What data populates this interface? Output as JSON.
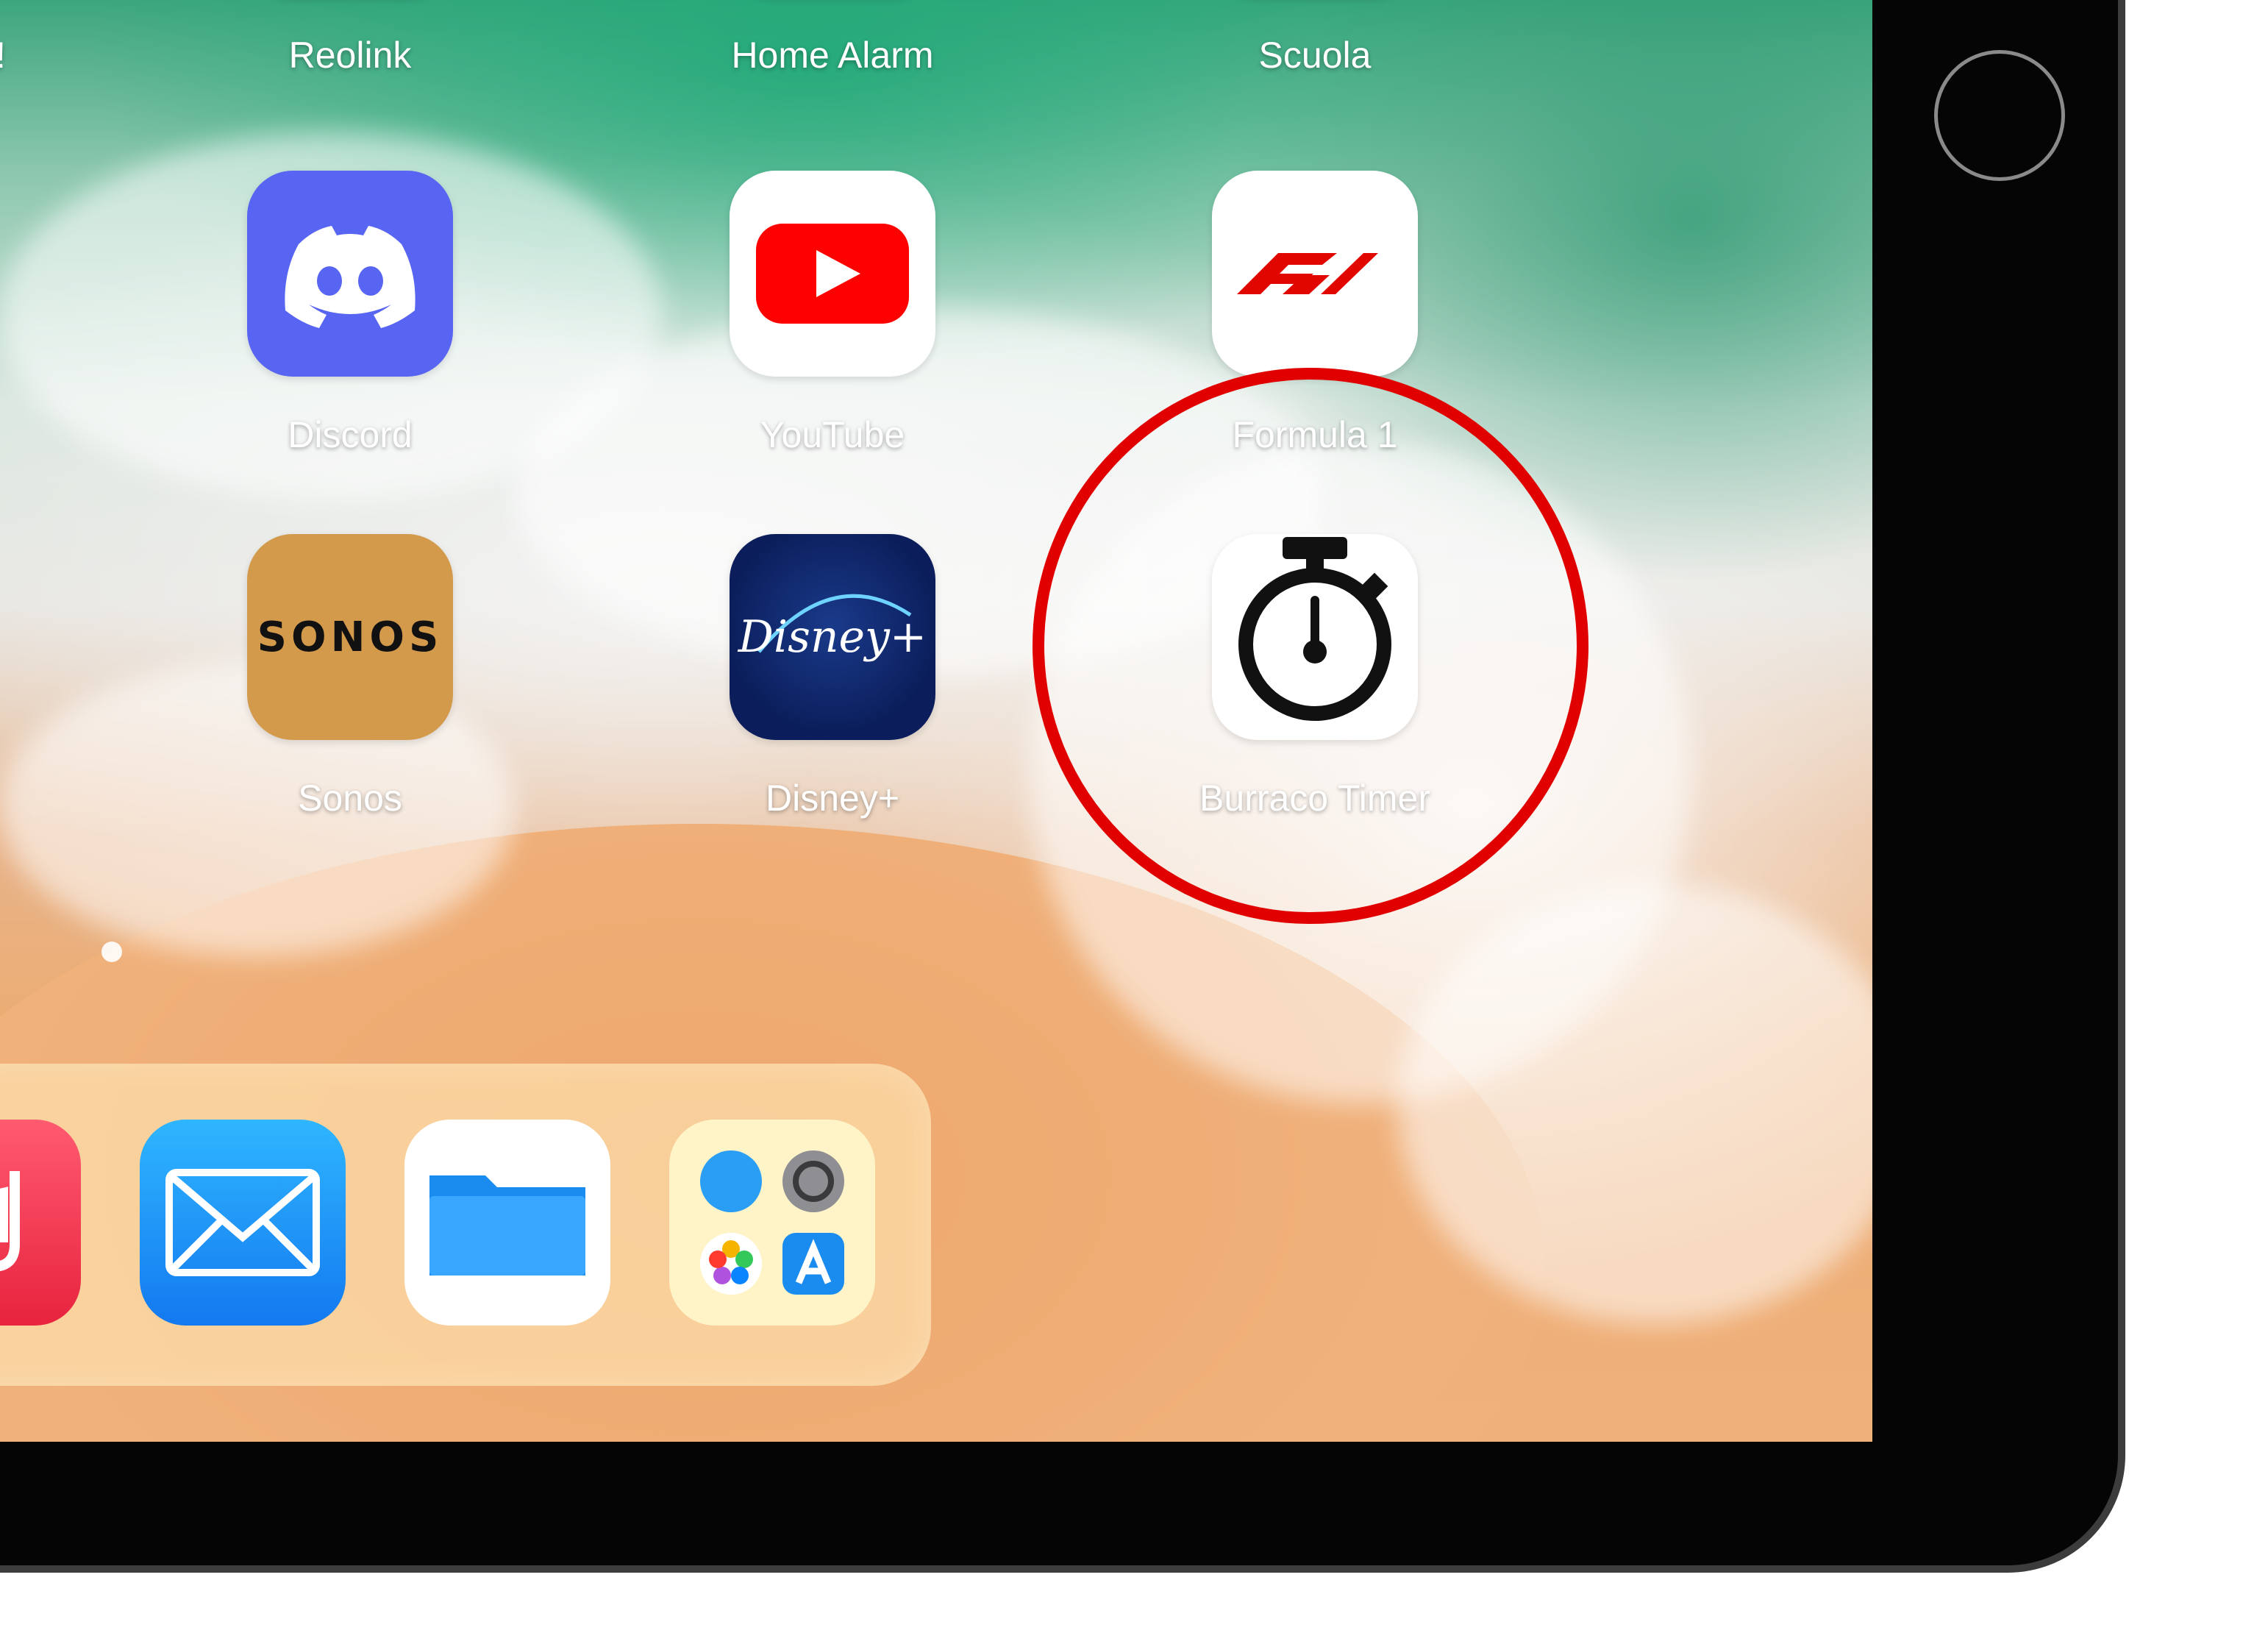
{
  "top_row": {
    "partial_label": "!",
    "labels": [
      "Reolink",
      "Home Alarm",
      "Scuola"
    ]
  },
  "apps": [
    {
      "name": "Discord",
      "color": "#5865F2"
    },
    {
      "name": "YouTube",
      "color": "#FF0000"
    },
    {
      "name": "Formula 1",
      "color": "#E10600"
    },
    {
      "name": "Sonos",
      "color": "#D49A4B",
      "wordmark": "SONOS"
    },
    {
      "name": "Disney+",
      "color": "#0B1E5B",
      "wordmark": "Disney+"
    },
    {
      "name": "Burraco Timer",
      "color": "#000000"
    }
  ],
  "dock": {
    "items": [
      "music-icon",
      "mail-icon",
      "files-icon",
      "recent-apps-folder-icon"
    ],
    "folder_items": [
      "safari-icon",
      "settings-icon",
      "photos-icon",
      "app-store-icon"
    ]
  },
  "annotation": {
    "target": "Burraco Timer",
    "color": "#e00000"
  }
}
